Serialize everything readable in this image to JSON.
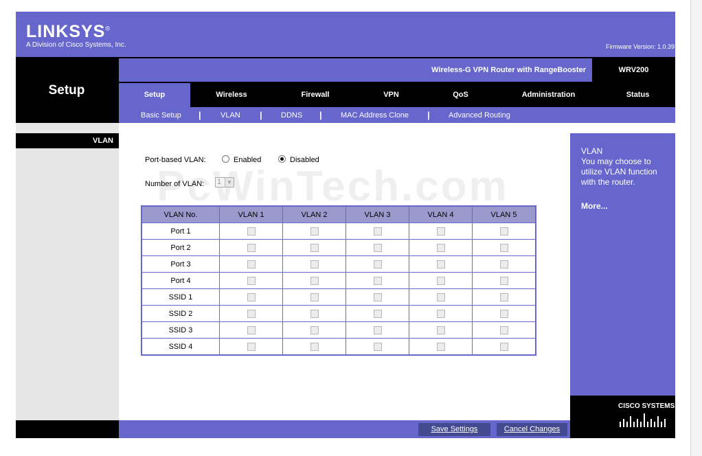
{
  "header": {
    "brand": "LINKSYS",
    "brand_mark": "®",
    "division": "A Division of Cisco Systems, Inc.",
    "firmware": "Firmware Version: 1.0.39",
    "section_title": "Setup",
    "product_name": "Wireless-G VPN Router with RangeBooster",
    "model": "WRV200"
  },
  "tabs": [
    {
      "label": "Setup",
      "active": true
    },
    {
      "label": "Wireless",
      "active": false
    },
    {
      "label": "Firewall",
      "active": false
    },
    {
      "label": "VPN",
      "active": false
    },
    {
      "label": "QoS",
      "active": false
    },
    {
      "label": "Administration",
      "active": false
    },
    {
      "label": "Status",
      "active": false
    }
  ],
  "subnav": [
    "Basic Setup",
    "VLAN",
    "DDNS",
    "MAC Address Clone",
    "Advanced Routing"
  ],
  "subnav_separator": "|",
  "sidebar": {
    "section_label": "VLAN"
  },
  "form": {
    "port_vlan_label": "Port-based VLAN:",
    "enabled_label": "Enabled",
    "disabled_label": "Disabled",
    "selected": "Disabled",
    "num_vlan_label": "Number of VLAN:",
    "num_vlan_value": "1",
    "watermark": "PcWinTech.com"
  },
  "table": {
    "headers": [
      "VLAN No.",
      "VLAN 1",
      "VLAN 2",
      "VLAN 3",
      "VLAN 4",
      "VLAN 5"
    ],
    "rows": [
      "Port 1",
      "Port 2",
      "Port 3",
      "Port 4",
      "SSID 1",
      "SSID 2",
      "SSID 3",
      "SSID 4"
    ]
  },
  "help": {
    "title": "VLAN",
    "text": "You may choose to utilize VLAN function with the router.",
    "more": "More..."
  },
  "footer": {
    "save": "Save Settings",
    "cancel": "Cancel Changes"
  },
  "cisco": {
    "logo_text": "CISCO SYSTEMS"
  },
  "colors": {
    "brand_purple": "#6666cc",
    "table_header": "#9999cc",
    "button_bg": "#434a8f"
  }
}
